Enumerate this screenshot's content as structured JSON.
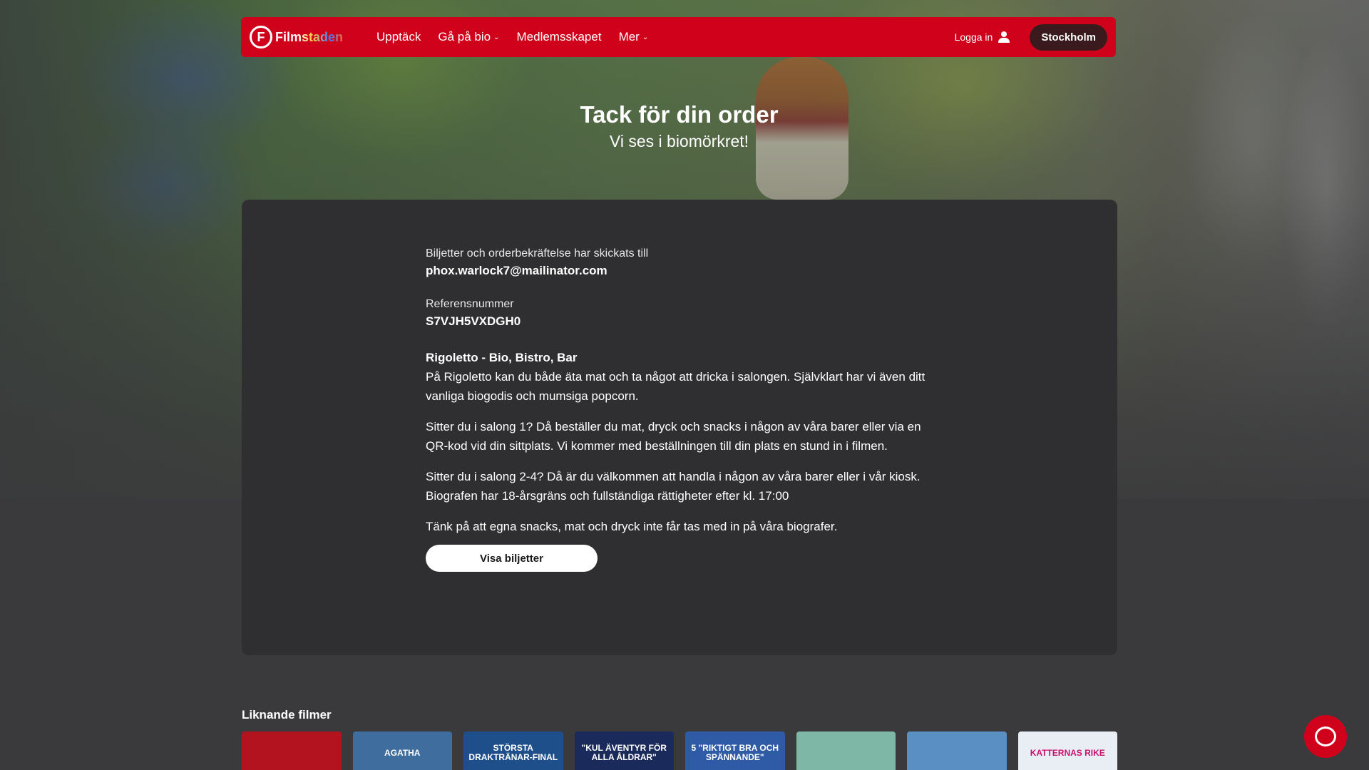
{
  "nav": {
    "logo_text": "Filmstaden",
    "links": [
      "Upptäck",
      "Gå på bio",
      "Medlemsskapet",
      "Mer"
    ],
    "login_label": "Logga in",
    "city": "Stockholm"
  },
  "hero": {
    "title": "Tack för din order",
    "subtitle": "Vi ses i biomörkret!"
  },
  "order": {
    "sent_label": "Biljetter och orderbekräftelse har skickats till",
    "email": "phox.warlock7@mailinator.com",
    "reference_label": "Referensnummer",
    "reference": "S7VJH5VXDGH0",
    "venue_heading": "Rigoletto - Bio, Bistro, Bar",
    "paragraphs": [
      "På Rigoletto kan du både äta mat och ta något att dricka i salongen. Självklart har vi även ditt vanliga biogodis och mumsiga popcorn.",
      "Sitter du i salong 1? Då beställer du mat, dryck och snacks i någon av våra barer eller via en QR-kod vid din sittplats. Vi kommer med beställningen till din plats en stund in i filmen.",
      "Sitter du i salong 2-4? Då är du välkommen att handla i någon av våra barer eller i vår kiosk.",
      "Biografen har 18-årsgräns och fullständiga rättigheter efter kl. 17:00",
      "Tänk på att egna snacks, mat och dryck inte får tas med in på våra biografer."
    ],
    "show_tickets_label": "Visa biljetter"
  },
  "similar": {
    "heading": "Liknande filmer",
    "posters": [
      {
        "text": "",
        "color": "#b3121f"
      },
      {
        "text": "AGATHA",
        "color": "#3f6e9e"
      },
      {
        "text": "STÖRSTA DRAKTRÄNAR-FINAL",
        "color": "#1f4f8a"
      },
      {
        "text": "\"KUL ÄVENTYR FÖR ALLA ÅLDRAR\"",
        "color": "#1a2a5a"
      },
      {
        "text": "5 \"RIKTIGT BRA OCH SPÄNNANDE\"",
        "color": "#2f5aa6"
      },
      {
        "text": "",
        "color": "#7fb7a6"
      },
      {
        "text": "",
        "color": "#5a8fc4"
      },
      {
        "text": "KATTERNAS RIKE",
        "color": "#e8eef4"
      }
    ]
  },
  "colors": {
    "brand_red": "#d0021b",
    "panel": "#2f2f31",
    "page": "#3a3a3c"
  }
}
